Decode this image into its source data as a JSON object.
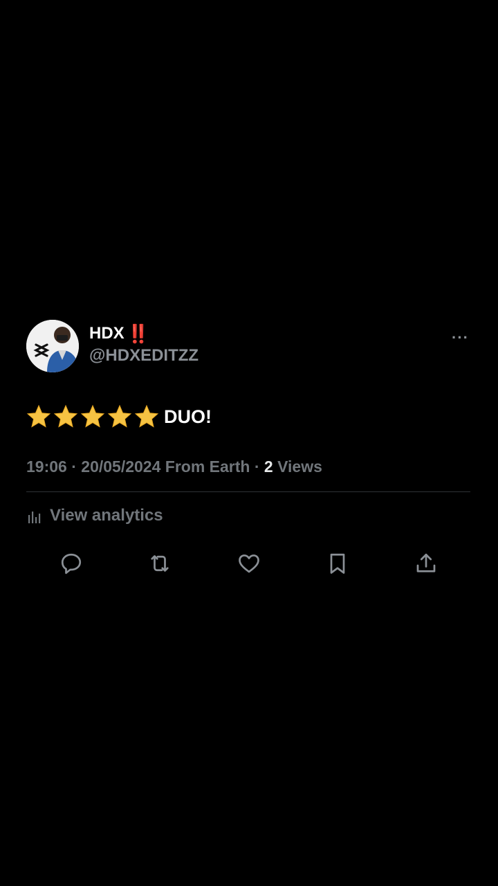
{
  "tweet": {
    "author": {
      "display_name": "HDX",
      "badge_emoji": "‼️",
      "handle": "@HDXEDITZZ",
      "avatar_icon": "capcut-logo-avatar"
    },
    "more_label": "···",
    "text": {
      "stars": [
        "⭐",
        "⭐",
        "⭐",
        "⭐",
        "⭐"
      ],
      "content": "DUO!"
    },
    "meta": {
      "time": "19:06",
      "separator": "·",
      "date_source": "20/05/2024 From Earth",
      "views_count": "2",
      "views_label": "Views"
    },
    "analytics_label": "View analytics",
    "actions": [
      {
        "name": "reply",
        "icon": "speech-bubble-icon"
      },
      {
        "name": "repost",
        "icon": "repost-icon"
      },
      {
        "name": "like",
        "icon": "heart-icon"
      },
      {
        "name": "bookmark",
        "icon": "bookmark-icon"
      },
      {
        "name": "share",
        "icon": "share-upload-icon"
      }
    ]
  },
  "colors": {
    "background": "#000000",
    "primary_text": "#ffffff",
    "secondary_text": "#71767b",
    "icon": "#8b9096",
    "divider": "#2f3336",
    "badge_red": "#e0242d",
    "star_yellow": "#f6c343"
  }
}
